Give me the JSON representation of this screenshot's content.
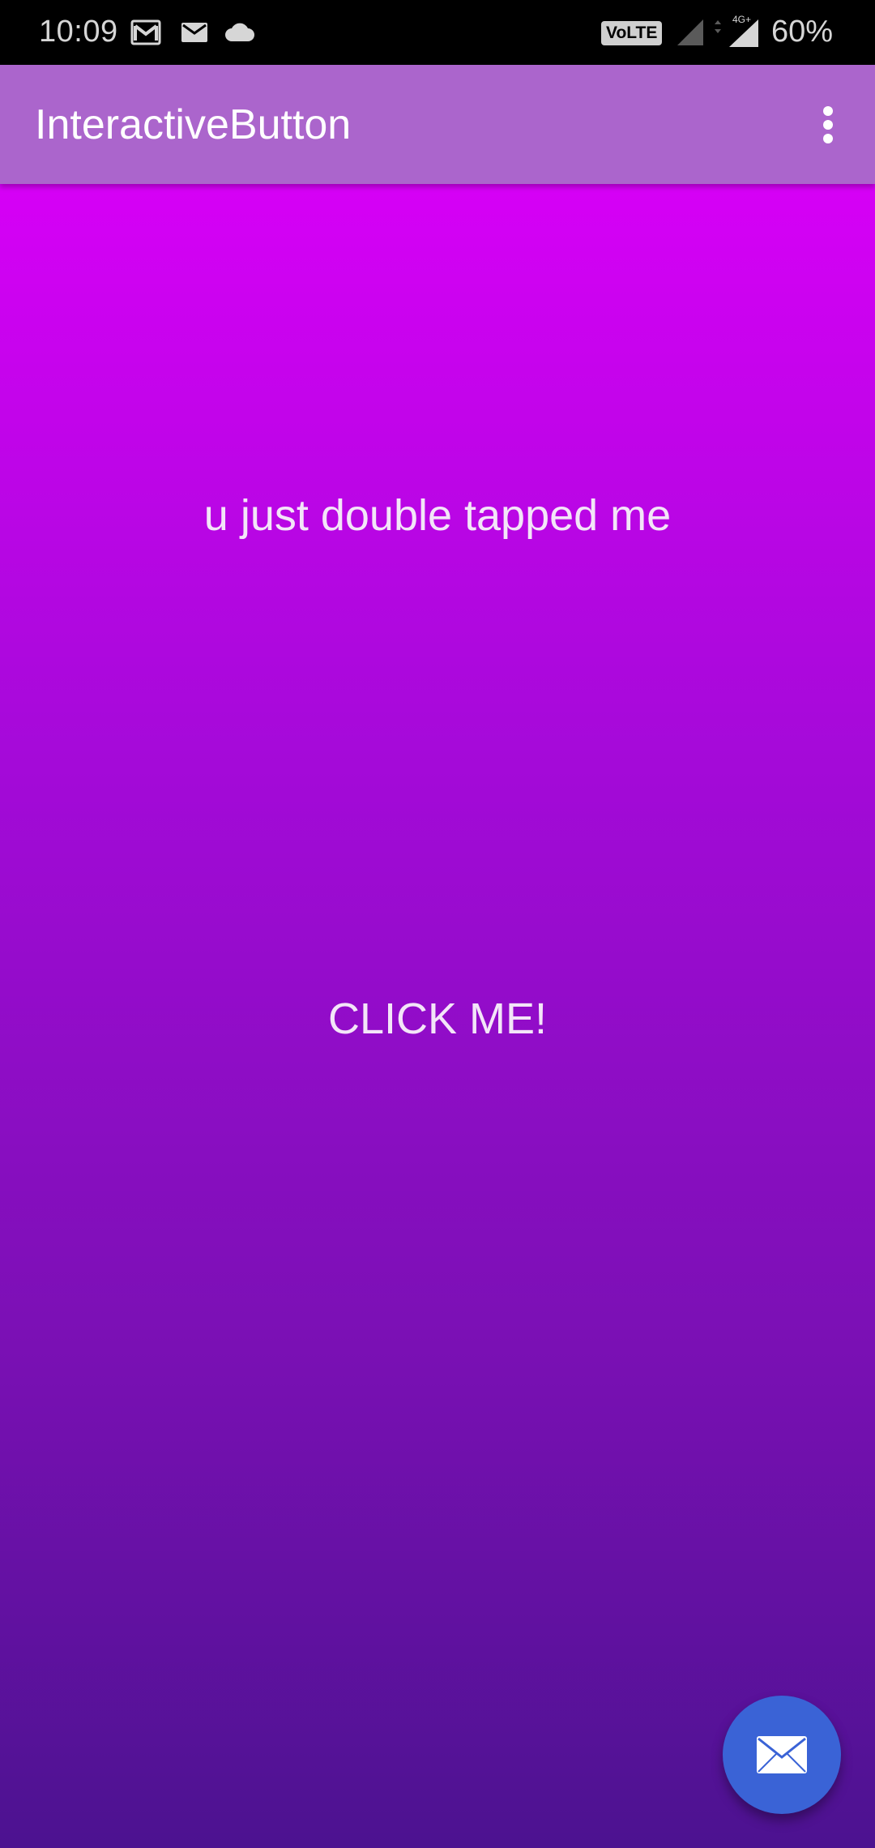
{
  "status_bar": {
    "time": "10:09",
    "volte": "VoLTE",
    "network": "4G+",
    "battery": "60%",
    "icons": [
      "gmail-icon",
      "mail-icon",
      "cloud-icon",
      "signal-icon",
      "signal-4g-icon"
    ]
  },
  "app_bar": {
    "title": "InteractiveButton",
    "menu_icon": "more-vert-icon",
    "color": "#ab65cc"
  },
  "content": {
    "message": "u just double tapped me",
    "button_label": "CLICK ME!",
    "gradient_top": "#d600f6",
    "gradient_bottom": "#4c1290"
  },
  "fab": {
    "icon": "envelope-icon",
    "color": "#3a63d6"
  }
}
